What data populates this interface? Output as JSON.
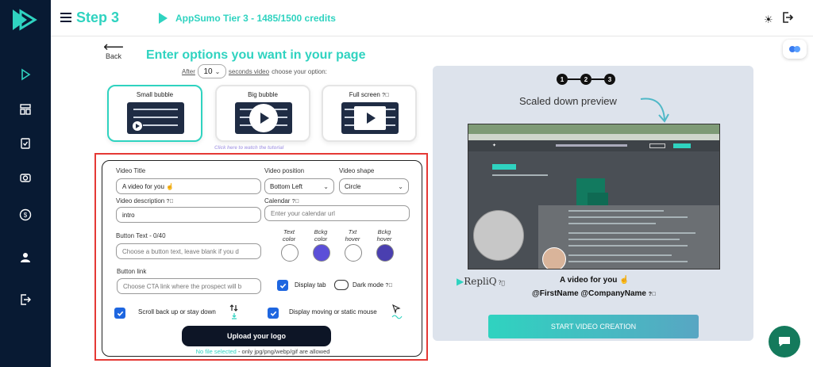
{
  "header": {
    "step_title": "Step 3",
    "credits": "AppSumo Tier 3 - 1485/1500 credits"
  },
  "sidebar": {
    "items": [
      {
        "icon": "play-icon"
      },
      {
        "icon": "layout-icon"
      },
      {
        "icon": "clipboard-check-icon"
      },
      {
        "icon": "camera-icon"
      },
      {
        "icon": "dollar-icon"
      },
      {
        "icon": "user-icon"
      },
      {
        "icon": "logout-icon"
      }
    ]
  },
  "back": {
    "label": "Back"
  },
  "options": {
    "heading": "Enter options you want in your page",
    "after_label": "After",
    "after_value": "10",
    "after_suffix": "seconds video",
    "after_tail": "choose your option:",
    "sizes": [
      {
        "label": "Small bubble",
        "selected": true
      },
      {
        "label": "Big bubble",
        "selected": false
      },
      {
        "label": "Full screen",
        "selected": false
      }
    ],
    "tutorial": "Click here to watch the tutorial"
  },
  "form": {
    "video_title_label": "Video Title",
    "video_title_value": "A video for you ☝",
    "video_position_label": "Video position",
    "video_position_value": "Bottom Left",
    "video_shape_label": "Video shape",
    "video_shape_value": "Circle",
    "video_description_label": "Video description",
    "video_description_value": "intro",
    "calendar_label": "Calendar",
    "calendar_placeholder": "Enter your calendar url",
    "button_text_label": "Button Text - 0/40",
    "button_text_placeholder": "Choose a button text, leave blank if you d",
    "color_labels": {
      "text_color": "Text color",
      "bckg_color": "Bckg color",
      "txt_hover": "Txt hover",
      "bckg_hover": "Bckg hover"
    },
    "colors": {
      "text_color": "#ffffff",
      "bckg_color": "#5b4fd8",
      "txt_hover": "#ffffff",
      "bckg_hover": "#4a3fb0"
    },
    "button_link_label": "Button link",
    "button_link_placeholder": "Choose CTA link where the prospect will b",
    "display_tab_label": "Display tab",
    "dark_mode_label": "Dark mode",
    "scroll_label": "Scroll back up or stay down",
    "display_mouse_label": "Display moving or static mouse",
    "upload_label": "Upload your logo",
    "no_file": "No file selected",
    "file_hint": "- only jpg/png/webp/gif are allowed"
  },
  "preview": {
    "steps": [
      "1",
      "2",
      "3"
    ],
    "title": "Scaled down preview",
    "brand": "RepliQ",
    "video_title": "A video for you ☝",
    "names": "@FirstName @CompanyName"
  },
  "start_button": "START VIDEO CREATION",
  "accent_colors": {
    "brand": "#2fd3c0",
    "sidebar": "#081a33",
    "highlight_frame": "#e53935",
    "chat": "#147a5c"
  }
}
